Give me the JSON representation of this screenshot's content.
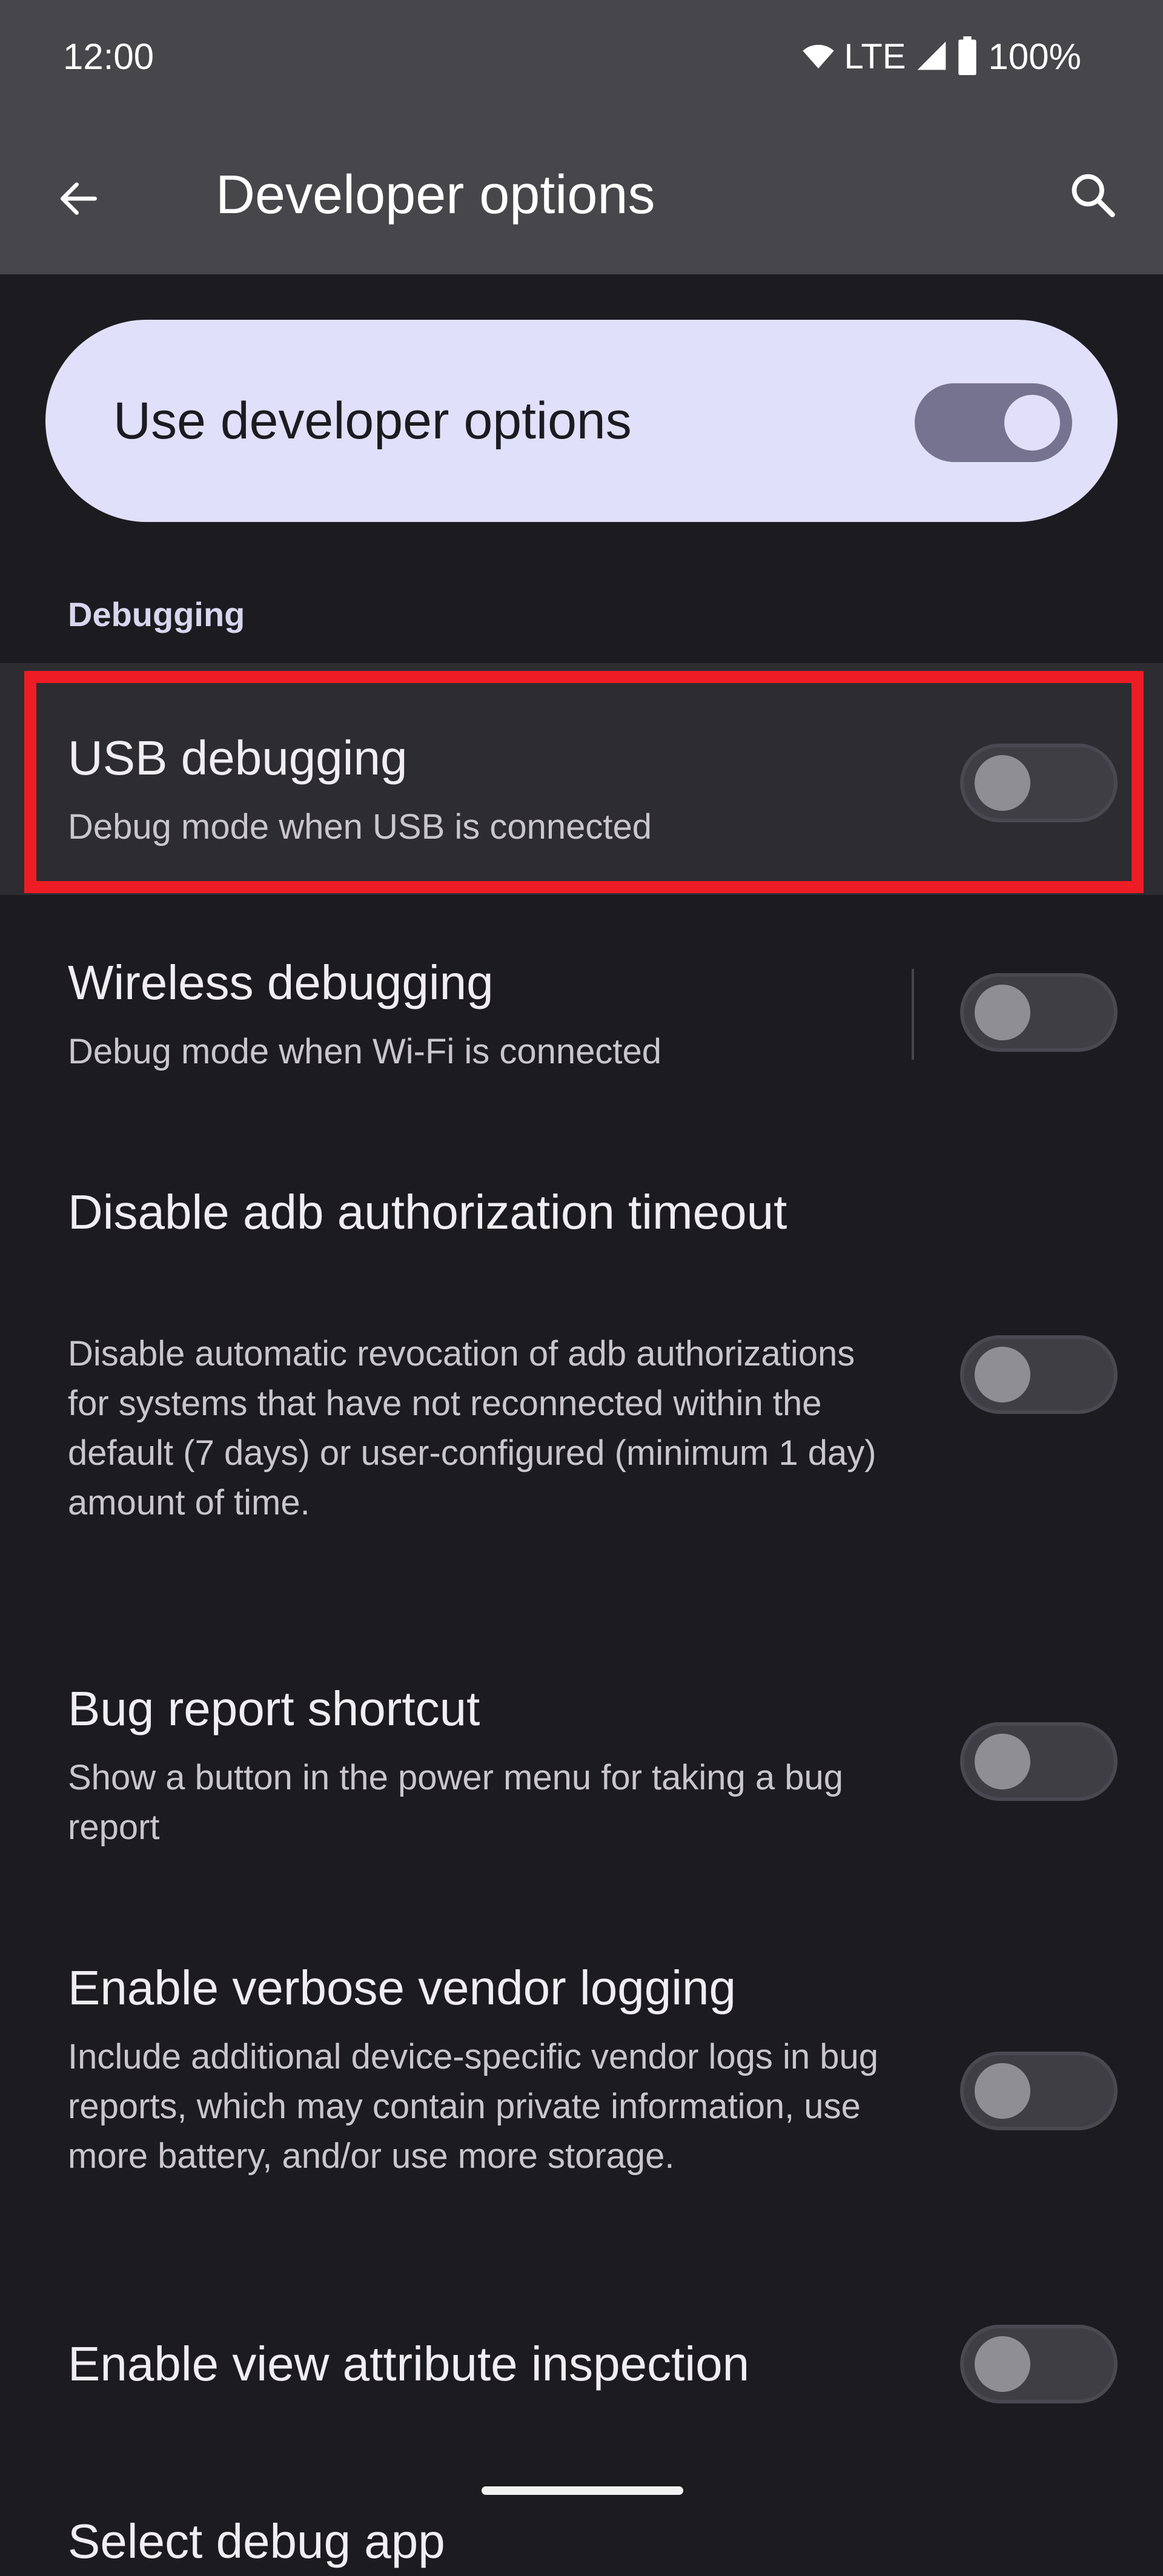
{
  "status_bar": {
    "time": "12:00",
    "network": "LTE",
    "battery": "100%",
    "icons": [
      "wifi-icon",
      "cell-signal-icon",
      "battery-icon"
    ]
  },
  "app_bar": {
    "title": "Developer options",
    "back_icon": "arrow-back-icon",
    "search_icon": "search-icon"
  },
  "master_switch": {
    "label": "Use developer options",
    "checked": true
  },
  "section": {
    "title": "Debugging"
  },
  "preferences": [
    {
      "title": "USB debugging",
      "summary": "Debug mode when USB is connected",
      "checked": false,
      "highlighted": true
    },
    {
      "title": "Wireless debugging",
      "summary": "Debug mode when Wi-Fi is connected",
      "checked": false,
      "has_divider": true
    },
    {
      "title": "Disable adb authorization timeout",
      "summary": "Disable automatic revocation of adb authorizations for systems that have not reconnected within the default (7 days) or user-configured (minimum 1 day) amount of time.",
      "checked": false
    },
    {
      "title": "Bug report shortcut",
      "summary": "Show a button in the power menu for taking a bug report",
      "checked": false
    },
    {
      "title": "Enable verbose vendor logging",
      "summary": "Include additional device-specific vendor logs in bug reports, which may contain private information, use more battery, and/or use more storage.",
      "checked": false
    },
    {
      "title": "Enable view attribute inspection",
      "summary": "",
      "checked": false
    }
  ],
  "cutoff_item": {
    "title": "Select debug app"
  },
  "colors": {
    "app_bar_bg": "#47464b",
    "page_bg": "#1c1b20",
    "master_card_bg": "#e1e0fa",
    "highlight_border": "#ee1c25",
    "toggle_on_track": "#75738f",
    "toggle_off_track": "#403e45"
  }
}
